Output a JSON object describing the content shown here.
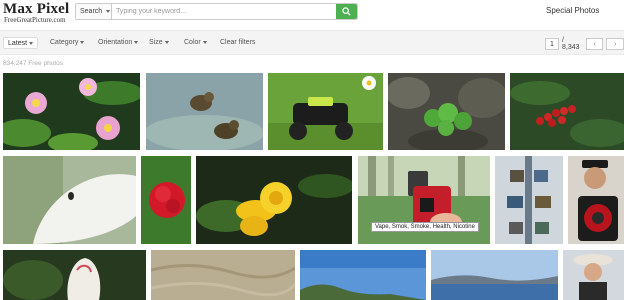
{
  "logo": {
    "title": "Max Pixel",
    "subtitle": "FreeGreatPicture.com"
  },
  "search": {
    "scope": "Search",
    "placeholder": "Typing your keyword...",
    "value": "",
    "button_icon": "search-icon"
  },
  "header": {
    "special_link": "Special Photos"
  },
  "filters": {
    "sort": "Latest",
    "items": [
      "Category",
      "Orientation",
      "Size",
      "Color"
    ],
    "clear": "Clear filters"
  },
  "pagination": {
    "current": "1",
    "total": "/ 8,343",
    "prev_icon": "chevron-left-icon",
    "next_icon": "chevron-right-icon"
  },
  "results": {
    "count": "834,247 Free photos"
  },
  "photos": [
    {
      "subject": "Water lilies"
    },
    {
      "subject": "Ducklings in water"
    },
    {
      "subject": "Toy ATV on grass"
    },
    {
      "subject": "Green plant on rocks"
    },
    {
      "subject": "Red berries"
    },
    {
      "subject": "White flower petal"
    },
    {
      "subject": "Red carnation"
    },
    {
      "subject": "Yellow flower"
    },
    {
      "subject": "Vape device",
      "tooltip": "Vape, Smok, Smoke, Health, Nicotine"
    },
    {
      "subject": "Decorative post"
    },
    {
      "subject": "Child with speaker"
    },
    {
      "subject": "Tulip"
    },
    {
      "subject": "Sand texture"
    },
    {
      "subject": "Sky and hills"
    },
    {
      "subject": "Lake landscape"
    },
    {
      "subject": "Girl in hat"
    }
  ],
  "colors": {
    "accent": "#4caf50",
    "filter_bg": "#f4f4f4"
  }
}
